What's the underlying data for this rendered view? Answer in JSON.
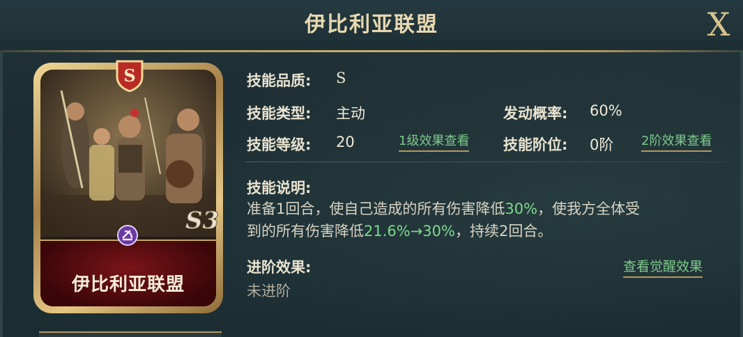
{
  "header": {
    "title": "伊比利亚联盟",
    "close_label": "X"
  },
  "card": {
    "name": "伊比利亚联盟",
    "grade_badge": "S",
    "season_mark": "S3"
  },
  "details": {
    "quality_label": "技能品质:",
    "quality_value": "S",
    "type_label": "技能类型:",
    "type_value": "主动",
    "level_label": "技能等级:",
    "level_value": "20",
    "level_link": "1级效果查看",
    "chance_label": "发动概率:",
    "chance_value": "60%",
    "tier_label": "技能阶位:",
    "tier_value": "0阶",
    "tier_link": "2阶效果查看"
  },
  "description": {
    "label": "技能说明:",
    "line1_a": "准备1回合，使自己造成的所有伤害降低",
    "line1_hl": "30%",
    "line1_b": "，使我方全体受",
    "line2_a": "到的所有伤害降低",
    "line2_hl": "21.6%→30%",
    "line2_b": "，持续2回合。"
  },
  "advance": {
    "label": "进阶效果:",
    "value": "未进阶",
    "link": "查看觉醒效果"
  },
  "colors": {
    "accent_gold": "#c8ae70",
    "highlight_green": "#7fd88e",
    "card_red": "#7a1418"
  }
}
